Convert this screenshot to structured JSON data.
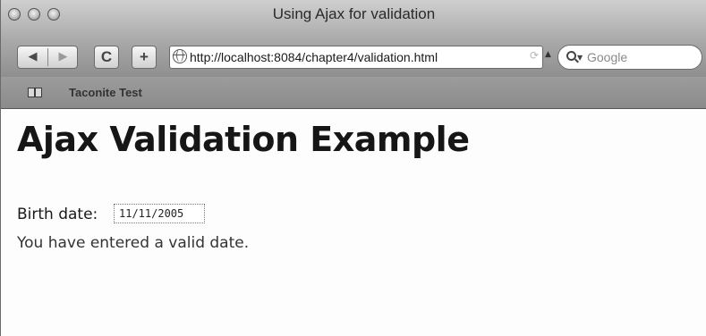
{
  "window": {
    "title": "Using Ajax for validation"
  },
  "toolbar": {
    "back_icon": "back-arrow-icon",
    "forward_icon": "forward-arrow-icon",
    "reload_glyph": "C",
    "add_bookmark_glyph": "+",
    "url": "http://localhost:8084/chapter4/validation.html",
    "search_placeholder": "Google"
  },
  "bookmarks_bar": {
    "items": [
      {
        "label": "Taconite Test"
      }
    ]
  },
  "page": {
    "heading": "Ajax Validation Example",
    "birth_date_label": "Birth date:",
    "birth_date_value": "11/11/2005",
    "status_message": "You have entered a valid date."
  }
}
